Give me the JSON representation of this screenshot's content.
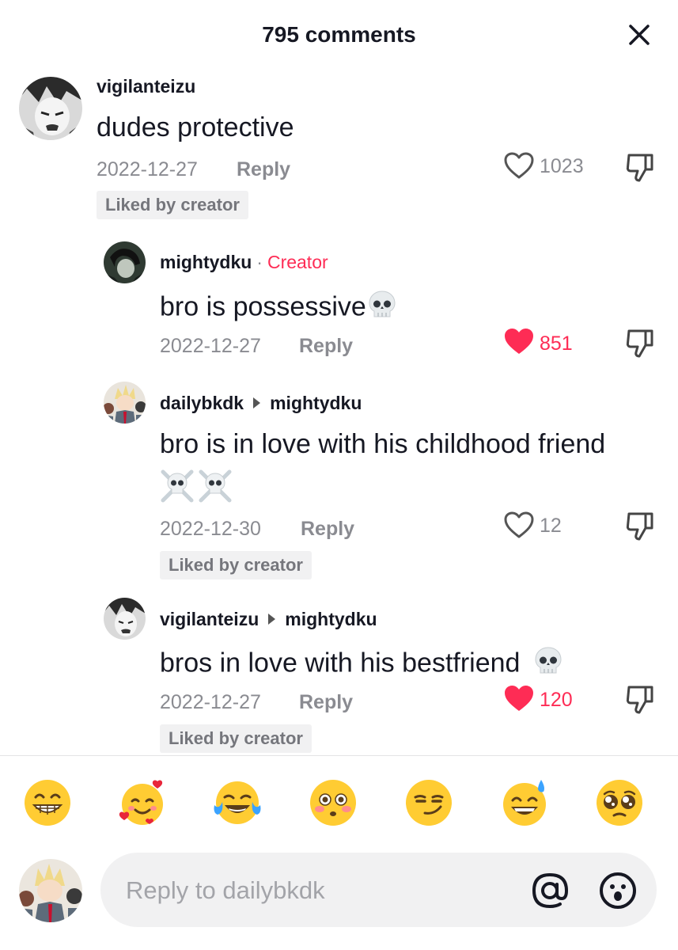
{
  "header": {
    "title": "795 comments"
  },
  "comments": [
    {
      "username": "vigilanteizu",
      "text": "dudes protective",
      "date": "2022-12-27",
      "reply_label": "Reply",
      "likes": "1023",
      "liked": false,
      "badge": "Liked by creator"
    },
    {
      "username": "mightydku",
      "tag": "Creator",
      "separator": "·",
      "text": "bro is possessive",
      "date": "2022-12-27",
      "reply_label": "Reply",
      "likes": "851",
      "liked": true
    },
    {
      "username": "dailybkdk",
      "reply_to": "mightydku",
      "text": "bro is in love with his childhood friend",
      "date": "2022-12-30",
      "reply_label": "Reply",
      "likes": "12",
      "liked": false,
      "badge": "Liked by creator"
    },
    {
      "username": "vigilanteizu",
      "reply_to": "mightydku",
      "text": "bros in love with his bestfriend",
      "date": "2022-12-27",
      "reply_label": "Reply",
      "likes": "120",
      "liked": true,
      "badge": "Liked by creator"
    }
  ],
  "emoji_bar": [
    "grinning-face",
    "smiling-face-with-hearts",
    "tears-of-joy",
    "flushed-face",
    "smirking-face",
    "grinning-sweat",
    "pleading-face"
  ],
  "reply_input": {
    "placeholder": "Reply to dailybkdk"
  },
  "colors": {
    "accent": "#fe2c55",
    "muted": "#8a8b91"
  }
}
